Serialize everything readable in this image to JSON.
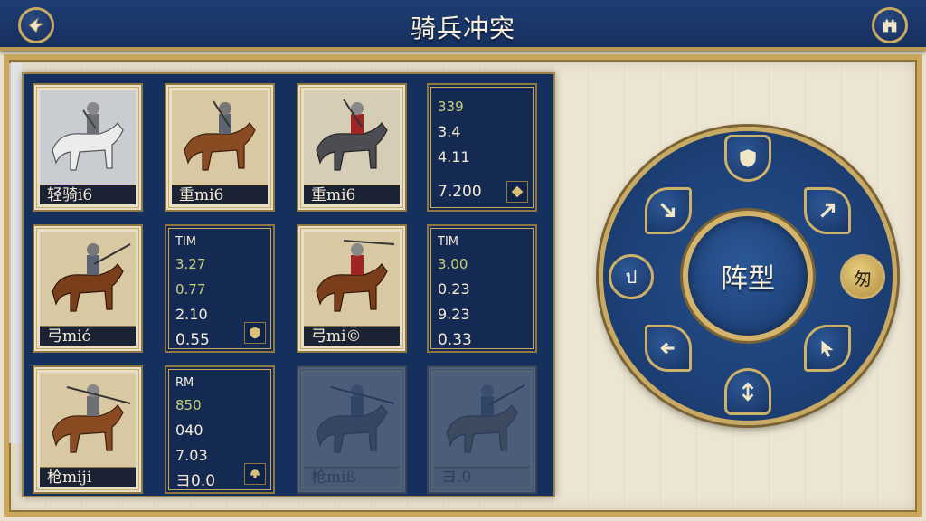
{
  "header": {
    "title": "骑兵冲突"
  },
  "units": {
    "light_horse": {
      "name": "轻骑i6"
    },
    "heavy_a": {
      "name": "重mi6"
    },
    "heavy_b": {
      "name": "重mi6"
    },
    "archer_a": {
      "name": "弓mić"
    },
    "archer_b": {
      "name": "弓mi©"
    },
    "lancer": {
      "name": "枪miji"
    },
    "lancer_faded": {
      "name": "枪miß"
    },
    "unknown_faded": {
      "name": "ヨ.0"
    }
  },
  "stats": {
    "panel1": {
      "l1": "339",
      "l2": "3.4",
      "l3": "4.11",
      "l4": "7.200"
    },
    "panel2": {
      "label": "TIM",
      "l1": "3.27",
      "l2": "0.77",
      "l3": "2.10",
      "l4": "0.55"
    },
    "panel3": {
      "label": "TIM",
      "l1": "3.00",
      "l2": "0.23",
      "l3": "9.23",
      "l4": "0.33"
    },
    "panel4": {
      "label": "RM",
      "l1": "850",
      "l2": "040",
      "l3": "7.03",
      "l4": "ヨ0.0"
    }
  },
  "wheel": {
    "center": "阵型",
    "left_glyph": "ป",
    "right_glyph": "匆"
  },
  "colors": {
    "navy": "#16305e",
    "gold": "#c9aa62",
    "parchment": "#ece5d2",
    "accent_text": "#c8d078"
  }
}
